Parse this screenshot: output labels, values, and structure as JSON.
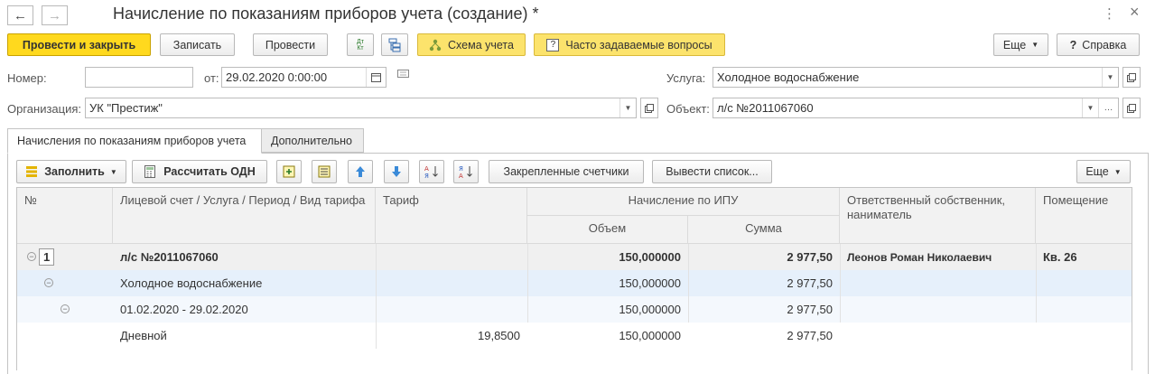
{
  "window": {
    "title": "Начисление по показаниям приборов учета (создание) *",
    "back_icon": "←",
    "forward_icon": "→",
    "menu_icon": "⋮",
    "close_icon": "×"
  },
  "toolbar": {
    "post_close": "Провести и закрыть",
    "write": "Записать",
    "post": "Провести",
    "dt_kt_top": "Дт",
    "dt_kt_bottom": "Кт",
    "scheme": "Схема учета",
    "faq": "Часто задаваемые вопросы",
    "more": "Еще",
    "help": "Справка"
  },
  "form": {
    "number_label": "Номер:",
    "number_value": "",
    "date_label": "от:",
    "date_value": "29.02.2020  0:00:00",
    "service_label": "Услуга:",
    "service_value": "Холодное водоснабжение",
    "org_label": "Организация:",
    "org_value": "УК \"Престиж\"",
    "object_label": "Объект:",
    "object_value": "л/с №2011067060"
  },
  "tabs": [
    {
      "label": "Начисления по показаниям приборов учета",
      "active": true
    },
    {
      "label": "Дополнительно",
      "active": false
    }
  ],
  "table_toolbar": {
    "fill": "Заполнить",
    "calc_odn": "Рассчитать ОДН",
    "fixed_meters": "Закрепленные счетчики",
    "output_list": "Вывести список...",
    "more": "Еще"
  },
  "table": {
    "headers": {
      "no": "№",
      "account": "Лицевой счет / Услуга / Период / Вид тарифа",
      "tariff": "Тариф",
      "ipu": "Начисление по ИПУ",
      "volume": "Объем",
      "sum": "Сумма",
      "owner": "Ответственный собственник, наниматель",
      "premises": "Помещение"
    },
    "rows": [
      {
        "no": "1",
        "account": "л/с №2011067060",
        "tariff": "",
        "volume": "150,000000",
        "sum": "2 977,50",
        "owner": "Леонов Роман Николаевич",
        "premises": "Кв. 26"
      },
      {
        "no": "",
        "account": "Холодное водоснабжение",
        "tariff": "",
        "volume": "150,000000",
        "sum": "2 977,50",
        "owner": "",
        "premises": ""
      },
      {
        "no": "",
        "account": "01.02.2020 - 29.02.2020",
        "tariff": "",
        "volume": "150,000000",
        "sum": "2 977,50",
        "owner": "",
        "premises": ""
      },
      {
        "no": "",
        "account": "Дневной",
        "tariff": "19,8500",
        "volume": "150,000000",
        "sum": "2 977,50",
        "owner": "",
        "premises": ""
      }
    ]
  },
  "colors": {
    "primary_button": "#ffd91e",
    "faq_button": "#fce36c",
    "header_bg": "#f2f2f2",
    "group_row_bg": "#f0f0f0",
    "selected_row_bg": "#e6f0fb"
  }
}
